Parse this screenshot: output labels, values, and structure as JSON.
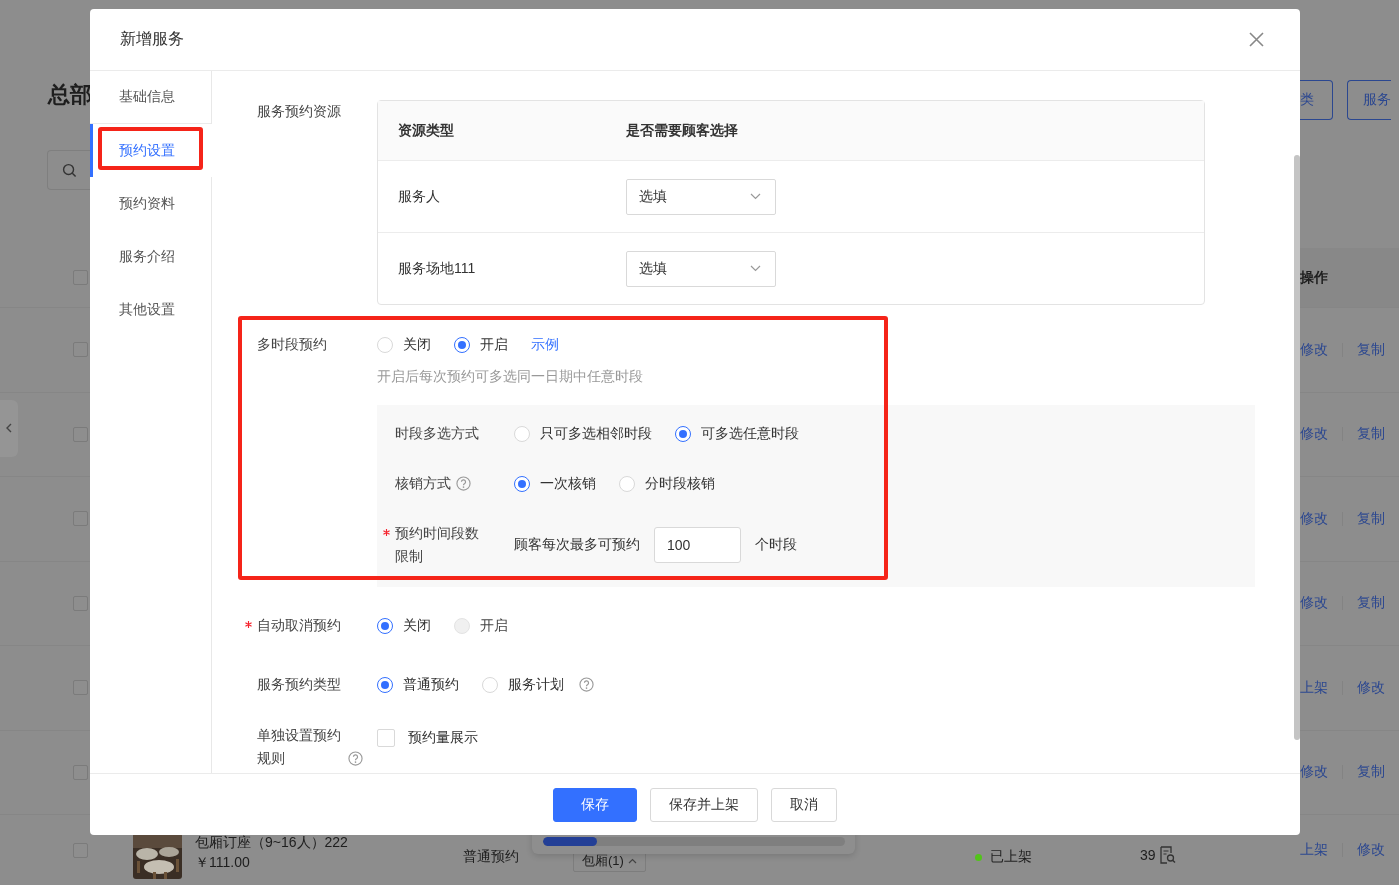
{
  "page": {
    "heading": "总部",
    "buttons": [
      "类",
      "服务"
    ],
    "header": {
      "checked": false,
      "action_label": "操作"
    },
    "rows": [
      {
        "checked": false,
        "actions": [
          "修改",
          "复制"
        ]
      },
      {
        "checked": false,
        "actions": [
          "修改",
          "复制"
        ]
      },
      {
        "checked": false,
        "actions": [
          "修改",
          "复制"
        ]
      },
      {
        "checked": false,
        "actions": [
          "修改",
          "复制"
        ]
      },
      {
        "checked": false,
        "actions": [
          "上架",
          "修改"
        ]
      },
      {
        "checked": false,
        "actions": [
          "修改",
          "复制"
        ]
      },
      {
        "checked": false,
        "actions": [
          "上架",
          "修改"
        ],
        "title": "包厢订座（9~16人）222",
        "price": "￥111.00",
        "type": "普通预约",
        "tag": "包厢(1)",
        "status": "已上架",
        "color": "#52c41a",
        "count": "39"
      }
    ],
    "progress": {
      "level": 0.18
    }
  },
  "dialog": {
    "title": "新增服务",
    "nav": [
      {
        "label": "基础信息",
        "selected": false
      },
      {
        "label": "预约设置",
        "selected": true
      },
      {
        "label": "预约资料",
        "selected": false
      },
      {
        "label": "服务介绍",
        "selected": false
      },
      {
        "label": "其他设置",
        "selected": false
      }
    ],
    "resource": {
      "label": "服务预约资源",
      "columns": [
        "资源类型",
        "是否需要顾客选择"
      ],
      "rows": [
        {
          "name": "服务人",
          "choice": "选填"
        },
        {
          "name": "服务场地111",
          "choice": "选填"
        }
      ]
    },
    "multi": {
      "label": "多时段预约",
      "options": [
        {
          "label": "关闭",
          "selected": false
        },
        {
          "label": "开启",
          "selected": true
        }
      ],
      "link": "示例",
      "hint": "开启后每次预约可多选同一日期中任意时段",
      "settings": [
        {
          "kind": "radio",
          "label": "时段多选方式",
          "options": [
            {
              "label": "只可多选相邻时段",
              "selected": false
            },
            {
              "label": "可多选任意时段",
              "selected": true
            }
          ]
        },
        {
          "kind": "radio",
          "label": "核销方式",
          "help": true,
          "options": [
            {
              "label": "一次核销",
              "selected": true
            },
            {
              "label": "分时段核销",
              "selected": false
            }
          ]
        },
        {
          "kind": "limit",
          "label": "预约时间段数限制",
          "required": true,
          "prefix": "顾客每次最多可预约",
          "value": "100",
          "suffix": "个时段"
        }
      ]
    },
    "fields": [
      {
        "kind": "radio",
        "label": "自动取消预约",
        "required": true,
        "options": [
          {
            "label": "关闭",
            "selected": true,
            "disabled": false
          },
          {
            "label": "开启",
            "selected": false,
            "disabled": true
          }
        ]
      },
      {
        "kind": "radio",
        "label": "服务预约类型",
        "options": [
          {
            "label": "普通预约",
            "selected": true
          },
          {
            "label": "服务计划",
            "selected": false,
            "help": true
          }
        ]
      },
      {
        "kind": "checkbox",
        "label": "单独设置预约规则",
        "help": true,
        "options": [
          {
            "label": "预约量展示",
            "checked": false
          }
        ]
      }
    ],
    "buttons": [
      {
        "label": "保存",
        "kind": "primary"
      },
      {
        "label": "保存并上架",
        "kind": "default"
      },
      {
        "label": "取消",
        "kind": "default"
      }
    ]
  }
}
